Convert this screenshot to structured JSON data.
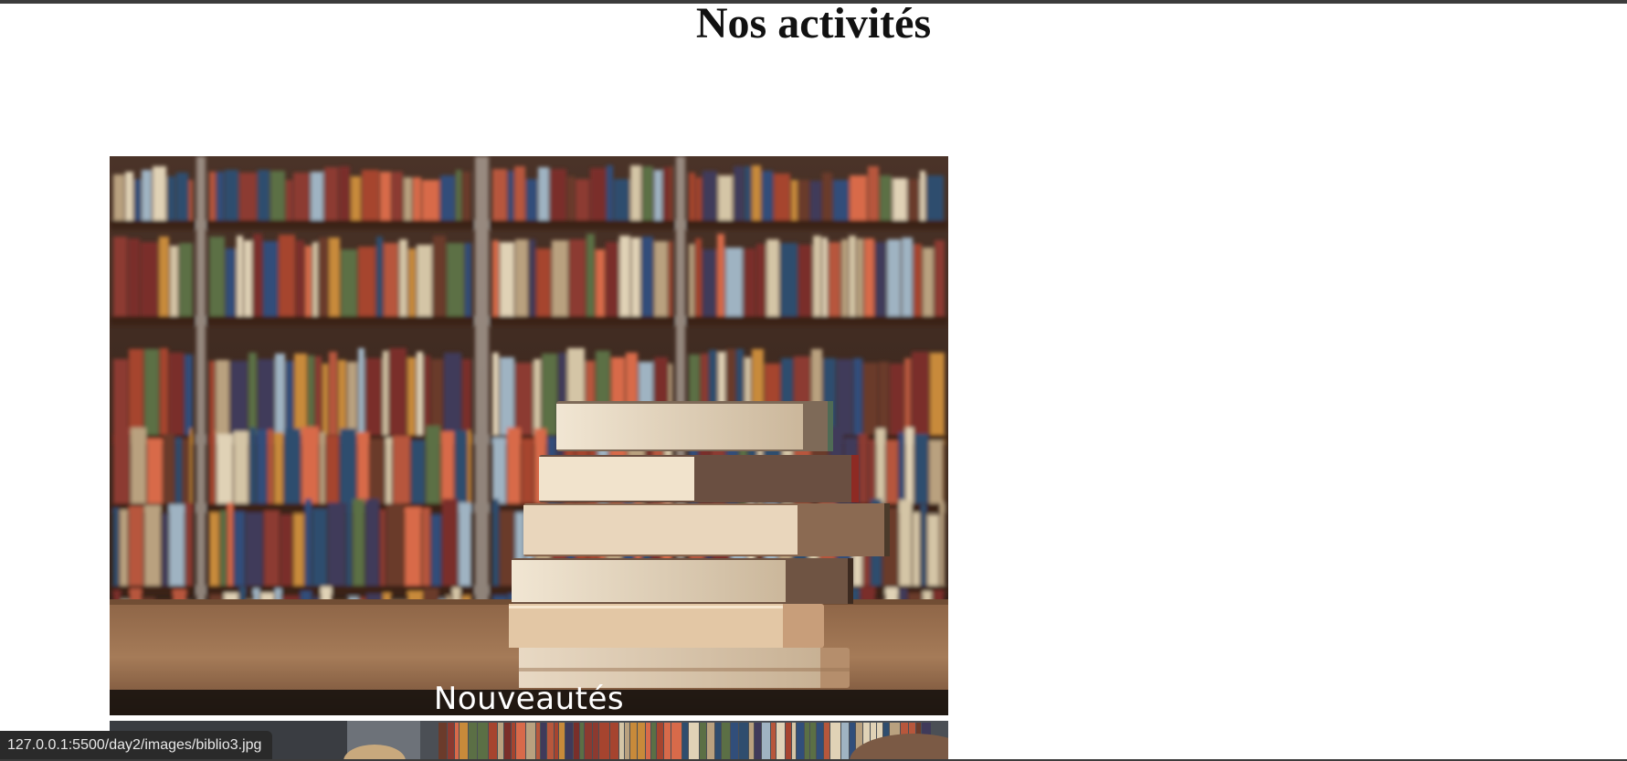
{
  "page": {
    "title": "Nos activités"
  },
  "activities": [
    {
      "caption": "Nouveautés",
      "image": "books-stack-library"
    },
    {
      "caption": "",
      "image": "library-shelves-reading"
    }
  ],
  "status_bar": {
    "url": "127.0.0.1:5500/day2/images/biblio3.jpg"
  },
  "colors": {
    "title": "#111111",
    "caption_band": "#14100c",
    "status_bar_bg": "#2a2a2a",
    "status_bar_text": "#e8e8e8"
  }
}
